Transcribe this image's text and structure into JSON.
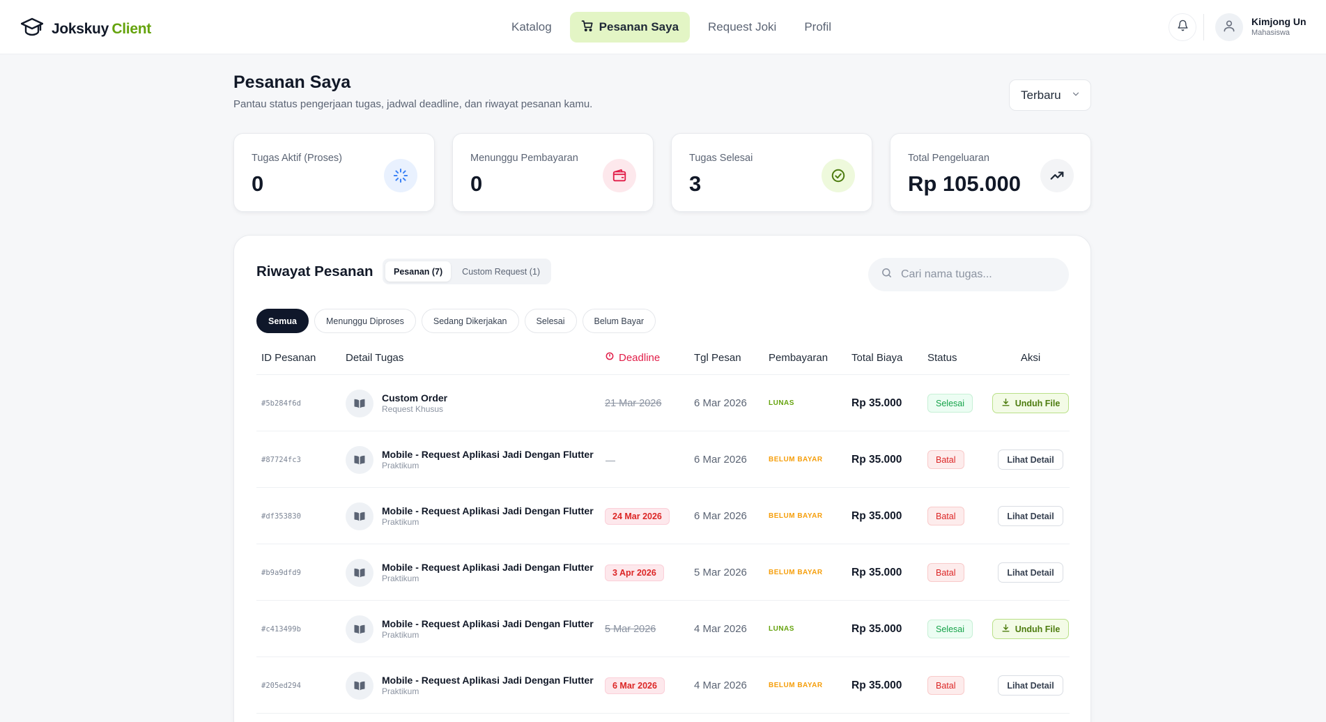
{
  "brand": {
    "name": "Jokskuy",
    "accent": "Client",
    "accent_color": "#65a30d"
  },
  "nav": {
    "items": [
      {
        "label": "Katalog"
      },
      {
        "label": "Pesanan Saya",
        "active": true
      },
      {
        "label": "Request Joki"
      },
      {
        "label": "Profil"
      }
    ]
  },
  "user": {
    "name": "Kimjong Un",
    "role": "Mahasiswa"
  },
  "page": {
    "title": "Pesanan Saya",
    "subtitle": "Pantau status pengerjaan tugas, jadwal deadline, dan riwayat pesanan kamu.",
    "sort": {
      "selected": "Terbaru"
    }
  },
  "stats": [
    {
      "label": "Tugas Aktif (Proses)",
      "value": "0",
      "icon": "loader-icon",
      "color": "#3b82f6"
    },
    {
      "label": "Menunggu Pembayaran",
      "value": "0",
      "icon": "wallet-icon",
      "color": "#e11d48"
    },
    {
      "label": "Tugas Selesai",
      "value": "3",
      "icon": "check-circle-icon",
      "color": "#65a30d"
    },
    {
      "label": "Total Pengeluaran",
      "value": "Rp 105.000",
      "icon": "trending-up-icon",
      "color": "#1f2937"
    }
  ],
  "history": {
    "title": "Riwayat Pesanan",
    "tabs": [
      {
        "label": "Pesanan (7)",
        "active": true
      },
      {
        "label": "Custom Request (1)"
      }
    ],
    "search_placeholder": "Cari nama tugas...",
    "filters": [
      {
        "label": "Semua",
        "active": true
      },
      {
        "label": "Menunggu Diproses"
      },
      {
        "label": "Sedang Dikerjakan"
      },
      {
        "label": "Selesai"
      },
      {
        "label": "Belum Bayar"
      }
    ],
    "columns": {
      "id": "ID Pesanan",
      "detail": "Detail Tugas",
      "deadline": "Deadline",
      "tgl": "Tgl Pesan",
      "pay": "Pembayaran",
      "total": "Total Biaya",
      "status": "Status",
      "action": "Aksi"
    },
    "rows": [
      {
        "id": "#5b284f6d",
        "name": "Custom Order",
        "category": "Request Khusus",
        "deadline": "21 Mar 2026",
        "deadline_style": "strike",
        "tgl": "6 Mar 2026",
        "pay": "LUNAS",
        "total": "Rp 35.000",
        "status": "Selesai",
        "action": "Unduh File"
      },
      {
        "id": "#87724fc3",
        "name": "Mobile - Request Aplikasi Jadi Dengan Flutter",
        "category": "Praktikum",
        "deadline": "—",
        "deadline_style": "dash",
        "tgl": "6 Mar 2026",
        "pay": "BELUM BAYAR",
        "total": "Rp 35.000",
        "status": "Batal",
        "action": "Lihat Detail"
      },
      {
        "id": "#df353830",
        "name": "Mobile - Request Aplikasi Jadi Dengan Flutter",
        "category": "Praktikum",
        "deadline": "24 Mar 2026",
        "deadline_style": "red",
        "tgl": "6 Mar 2026",
        "pay": "BELUM BAYAR",
        "total": "Rp 35.000",
        "status": "Batal",
        "action": "Lihat Detail"
      },
      {
        "id": "#b9a9dfd9",
        "name": "Mobile - Request Aplikasi Jadi Dengan Flutter",
        "category": "Praktikum",
        "deadline": "3 Apr 2026",
        "deadline_style": "red",
        "tgl": "5 Mar 2026",
        "pay": "BELUM BAYAR",
        "total": "Rp 35.000",
        "status": "Batal",
        "action": "Lihat Detail"
      },
      {
        "id": "#c413499b",
        "name": "Mobile - Request Aplikasi Jadi Dengan Flutter",
        "category": "Praktikum",
        "deadline": "5 Mar 2026",
        "deadline_style": "strike",
        "tgl": "4 Mar 2026",
        "pay": "LUNAS",
        "total": "Rp 35.000",
        "status": "Selesai",
        "action": "Unduh File"
      },
      {
        "id": "#205ed294",
        "name": "Mobile - Request Aplikasi Jadi Dengan Flutter",
        "category": "Praktikum",
        "deadline": "6 Mar 2026",
        "deadline_style": "red",
        "tgl": "4 Mar 2026",
        "pay": "BELUM BAYAR",
        "total": "Rp 35.000",
        "status": "Batal",
        "action": "Lihat Detail"
      }
    ]
  }
}
